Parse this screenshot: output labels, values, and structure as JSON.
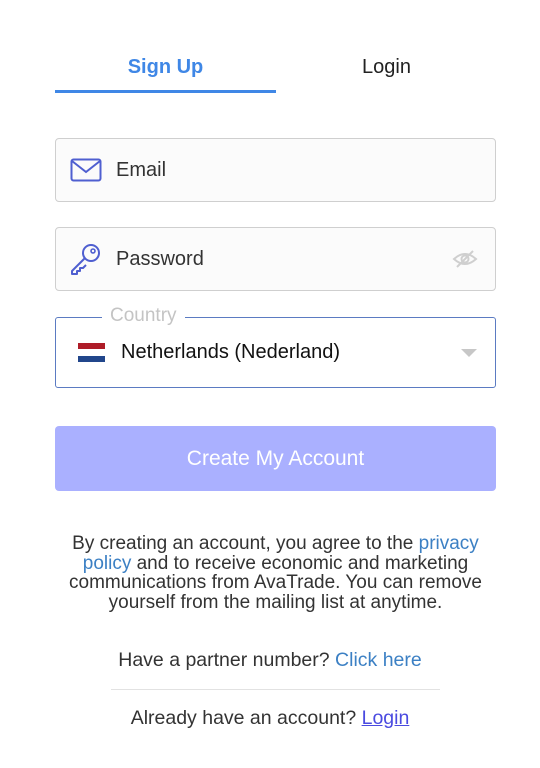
{
  "tabs": [
    {
      "label": "Sign Up",
      "active": true
    },
    {
      "label": "Login",
      "active": false
    }
  ],
  "email": {
    "placeholder": "Email",
    "value": "",
    "icon": "envelope-icon"
  },
  "password": {
    "placeholder": "Password",
    "value": "",
    "icon": "key-icon",
    "toggle_icon": "eye-slash-icon"
  },
  "country": {
    "label": "Country",
    "value": "Netherlands (Nederland)",
    "flag_colors": [
      "#ae1c28",
      "#ffffff",
      "#21468b"
    ]
  },
  "submit": {
    "label": "Create My Account"
  },
  "consent": {
    "prefix": "By creating an account, you agree to the ",
    "link": "privacy policy",
    "suffix": " and to receive economic and marketing communications from AvaTrade. You can remove yourself from the mailing list at anytime."
  },
  "partner": {
    "text": "Have a partner number? ",
    "link": "Click here"
  },
  "account": {
    "text": "Already have an account? ",
    "link": "Login"
  },
  "colors": {
    "accent": "#3f87e6",
    "button": "#aab0ff",
    "link": "#3c80c4",
    "icon": "#4f5fd0"
  }
}
